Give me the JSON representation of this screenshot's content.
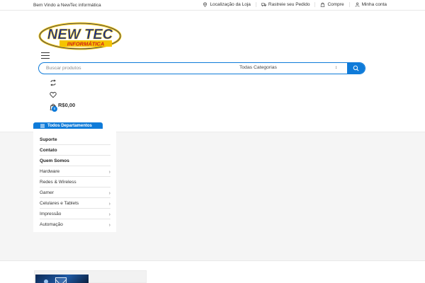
{
  "topbar": {
    "welcome": "Bem Vindo a NewTec informática",
    "links": [
      {
        "label": "Localização da Loja",
        "icon": "map-pin-icon"
      },
      {
        "label": "Rastreie seu Pedido",
        "icon": "truck-icon"
      },
      {
        "label": "Compre",
        "icon": "shopping-bag-icon"
      },
      {
        "label": "Minha conta",
        "icon": "user-icon"
      }
    ]
  },
  "logo": {
    "line1": "NEW TEC",
    "line2": "INFORMÁTICA"
  },
  "search": {
    "placeholder": "Buscar produtos",
    "category": "Todas Categorias"
  },
  "cart": {
    "count": "0",
    "total": "R$0,00"
  },
  "departments": {
    "header": "Todos Departamentos",
    "items": [
      {
        "label": "Suporte",
        "bold": true,
        "arrow": false
      },
      {
        "label": "Contato",
        "bold": true,
        "arrow": false
      },
      {
        "label": "Quem Somos",
        "bold": true,
        "arrow": false
      },
      {
        "label": "Hardware",
        "bold": false,
        "arrow": true
      },
      {
        "label": "Redes & Wireless",
        "bold": false,
        "arrow": false
      },
      {
        "label": "Gamer",
        "bold": false,
        "arrow": true
      },
      {
        "label": "Celulares e Tablets",
        "bold": false,
        "arrow": true
      },
      {
        "label": "Impressão",
        "bold": false,
        "arrow": true
      },
      {
        "label": "Automação",
        "bold": false,
        "arrow": true
      }
    ]
  },
  "colors": {
    "accent": "#0f7bd9",
    "logo_yellow": "#f5c400",
    "logo_blue": "#1a2f8a",
    "logo_red": "#d4221b"
  }
}
